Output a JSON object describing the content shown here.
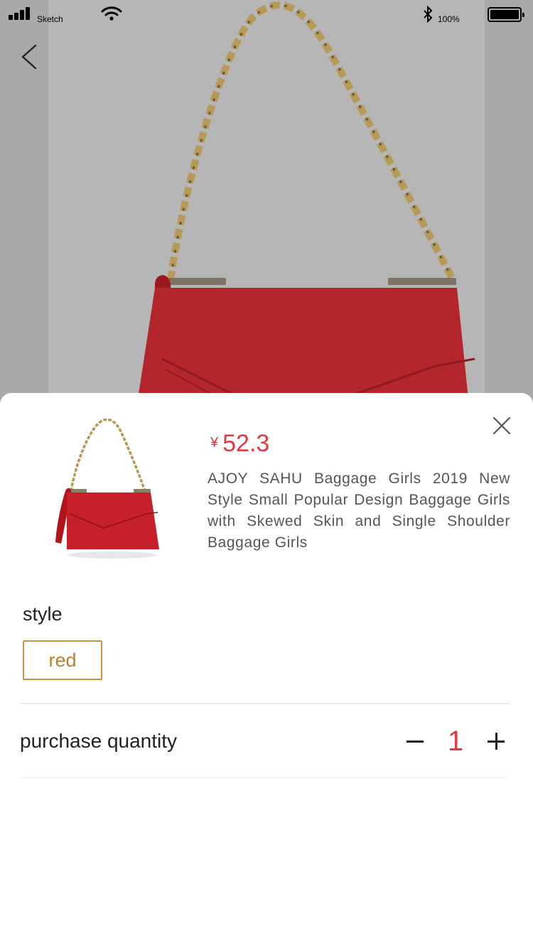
{
  "status_bar": {
    "carrier": "Sketch",
    "battery_percent": "100%"
  },
  "product": {
    "currency_symbol": "¥",
    "price": "52.3",
    "title": "AJOY SAHU Baggage Girls 2019 New Style Small Popular Design Baggage Girls with Skewed Skin and Single Shoulder Baggage Girls",
    "image_icon": "red-handbag-image"
  },
  "options": {
    "style_label": "style",
    "selected_style": "red",
    "accent_color": "#c8953e"
  },
  "quantity": {
    "label": "purchase quantity",
    "value": "1"
  },
  "colors": {
    "price": "#e03a45",
    "backdrop": "#a9a9a9"
  }
}
